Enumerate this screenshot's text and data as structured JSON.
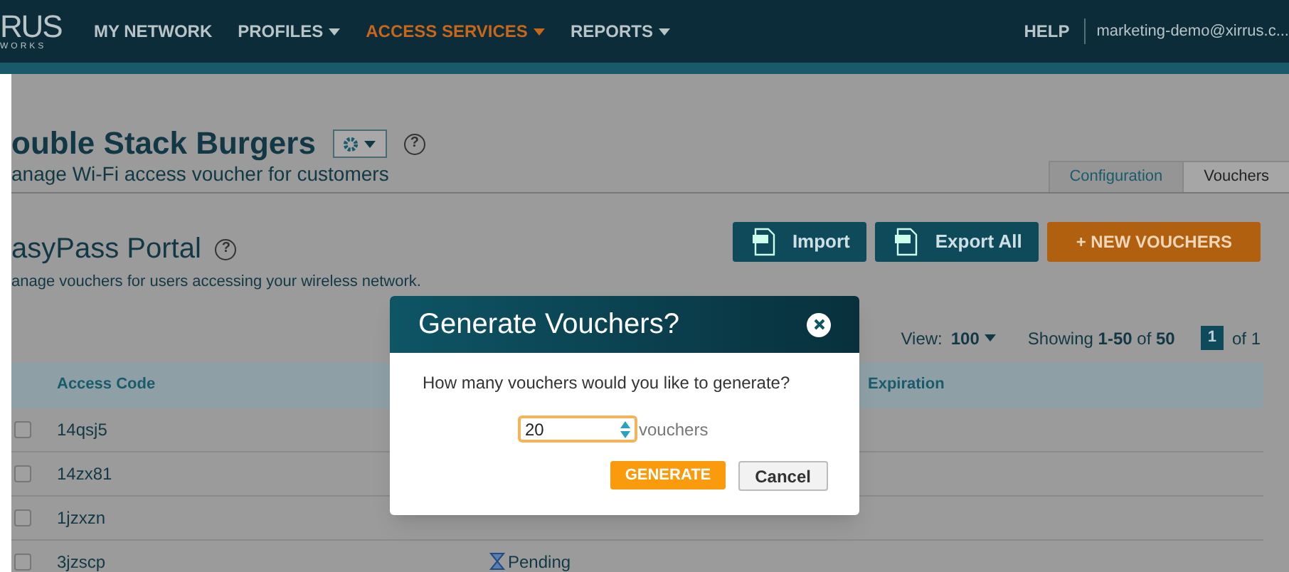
{
  "header": {
    "logo_top": "RUS",
    "logo_bottom": "WORKS",
    "nav": [
      {
        "label": "MY NETWORK",
        "dropdown": false,
        "selected": false
      },
      {
        "label": "PROFILES",
        "dropdown": true,
        "selected": false
      },
      {
        "label": "ACCESS SERVICES",
        "dropdown": true,
        "selected": true
      },
      {
        "label": "REPORTS",
        "dropdown": true,
        "selected": false
      }
    ],
    "help": "HELP",
    "user": "marketing-demo@xirrus.c..."
  },
  "page": {
    "help_mark": "?",
    "title": "ouble Stack Burgers",
    "subtitle": "anage Wi-Fi access voucher for customers",
    "tabs": [
      {
        "label": "Configuration",
        "selected": false
      },
      {
        "label": "Vouchers",
        "selected": true
      }
    ]
  },
  "portal": {
    "help_mark": "?",
    "title": "asyPass Portal",
    "subtitle": "anage vouchers for users accessing your wireless network.",
    "buttons": [
      {
        "kind": "csv",
        "label": "Import"
      },
      {
        "kind": "csv",
        "label": "Export All"
      },
      {
        "kind": "primary",
        "label": "+ NEW VOUCHERS"
      }
    ],
    "view_label": "View:",
    "view_value": "100",
    "showing": "Showing **1-50** of **50**",
    "page": "1",
    "of": "of 1",
    "table": {
      "columns": [
        "Access Code",
        "Expiration"
      ],
      "rows": [
        {
          "code": "14qsj5",
          "checked": false
        },
        {
          "code": "14zx81",
          "checked": false
        },
        {
          "code": "1jzxzn",
          "checked": false
        },
        {
          "code": "3jzscp",
          "checked": false,
          "status": "Pending"
        }
      ]
    }
  },
  "dialog": {
    "title": "Generate Vouchers?",
    "question": "How many vouchers would you like to generate?",
    "value": "20",
    "unit": "vouchers",
    "buttons": [
      {
        "kind": "primary",
        "label": "GENERATE"
      },
      {
        "kind": "secondary",
        "label": "Cancel"
      }
    ]
  }
}
